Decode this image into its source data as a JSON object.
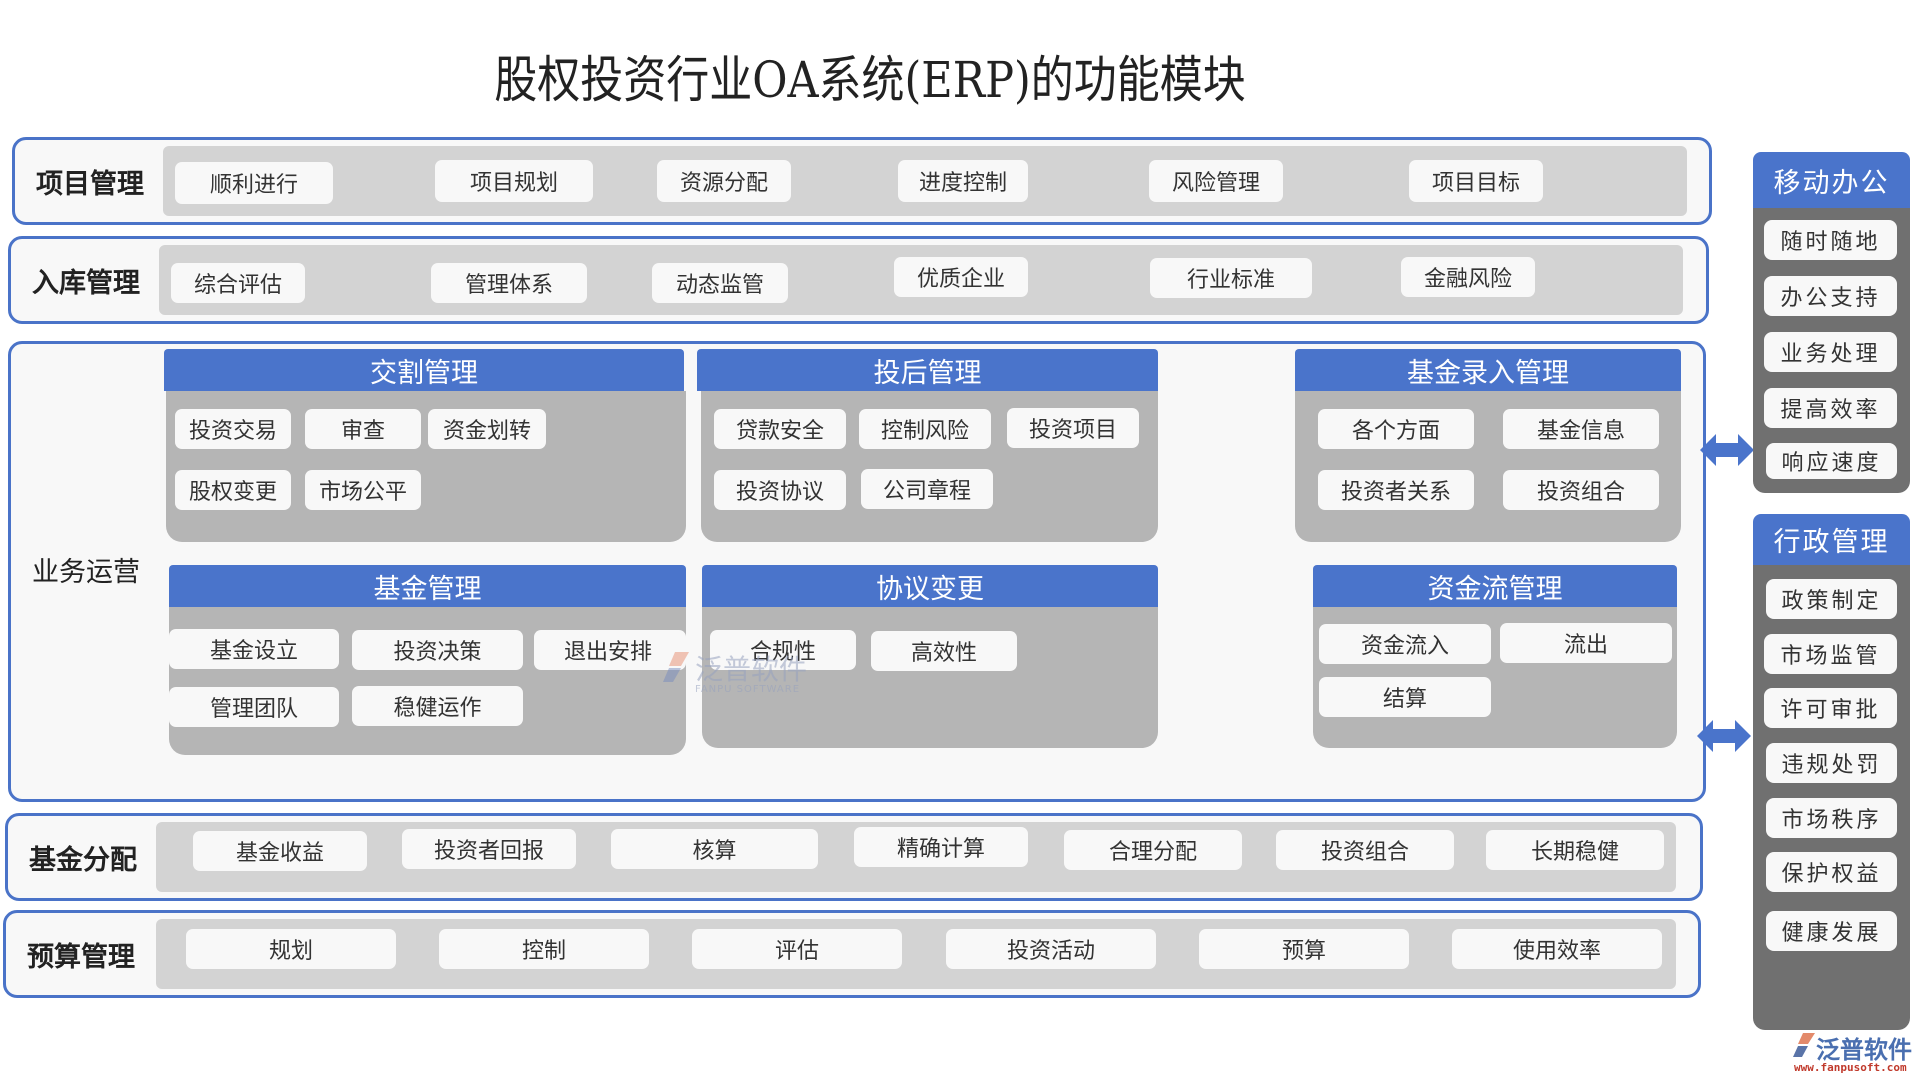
{
  "title": "股权投资行业OA系统(ERP)的功能模块",
  "rows": {
    "project": {
      "label": "项目管理",
      "items": [
        "顺利进行",
        "项目规划",
        "资源分配",
        "进度控制",
        "风险管理",
        "项目目标"
      ]
    },
    "storage": {
      "label": "入库管理",
      "items": [
        "综合评估",
        "管理体系",
        "动态监管",
        "优质企业",
        "行业标准",
        "金融风险"
      ]
    },
    "business": {
      "label": "业务运营",
      "groups": [
        {
          "title": "交割管理",
          "items": [
            "投资交易",
            "审查",
            "资金划转",
            "股权变更",
            "市场公平"
          ]
        },
        {
          "title": "投后管理",
          "items": [
            "贷款安全",
            "控制风险",
            "投资项目",
            "投资协议",
            "公司章程"
          ]
        },
        {
          "title": "基金录入管理",
          "items": [
            "各个方面",
            "基金信息",
            "投资者关系",
            "投资组合"
          ]
        },
        {
          "title": "基金管理",
          "items": [
            "基金设立",
            "投资决策",
            "退出安排",
            "管理团队",
            "稳健运作"
          ]
        },
        {
          "title": "协议变更",
          "items": [
            "合规性",
            "高效性"
          ]
        },
        {
          "title": "资金流管理",
          "items": [
            "资金流入",
            "流出",
            "结算"
          ]
        }
      ]
    },
    "distribution": {
      "label": "基金分配",
      "items": [
        "基金收益",
        "投资者回报",
        "核算",
        "精确计算",
        "合理分配",
        "投资组合",
        "长期稳健"
      ]
    },
    "budget": {
      "label": "预算管理",
      "items": [
        "规划",
        "控制",
        "评估",
        "投资活动",
        "预算",
        "使用效率"
      ]
    }
  },
  "side": {
    "mobile": {
      "title": "移动办公",
      "items": [
        "随时随地",
        "办公支持",
        "业务处理",
        "提高效率",
        "响应速度"
      ]
    },
    "admin": {
      "title": "行政管理",
      "items": [
        "政策制定",
        "市场监管",
        "许可审批",
        "违规处罚",
        "市场秩序",
        "保护权益",
        "健康发展"
      ]
    }
  },
  "watermark": {
    "cn": "泛普软件",
    "en": "FANPU SOFTWARE"
  },
  "logo": {
    "name": "泛普软件",
    "url": "www.fanpusoft.com"
  },
  "colors": {
    "accent": "#4a74cb",
    "border": "#4a73c8",
    "panel_gray": "#b5b5b5",
    "row_gray": "#d3d3d3",
    "side_dark": "#707070",
    "chip": "#f8f8f8"
  }
}
